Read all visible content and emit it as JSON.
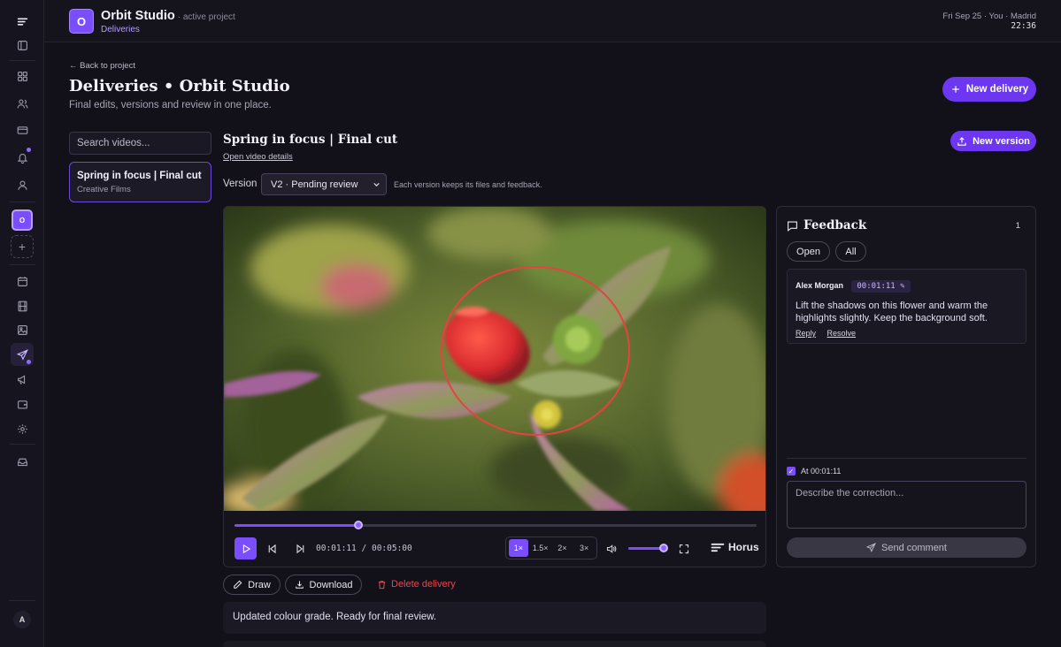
{
  "project": {
    "initial": "O",
    "name": "Orbit Studio",
    "status": "· active project",
    "breadcrumb": "Deliveries"
  },
  "clock": {
    "line1": "Fri Sep 25 · You · Madrid",
    "time": "22:36"
  },
  "sidebar": {
    "project_initial": "O",
    "add_label": "+",
    "user_initial": "A"
  },
  "page": {
    "back_link": "← Back to project",
    "title": "Deliveries • Orbit Studio",
    "subtitle": "Final edits, versions and review in one place.",
    "new_delivery": "New delivery"
  },
  "videos": {
    "search_placeholder": "Search videos...",
    "items": [
      {
        "title": "Spring in focus | Final cut",
        "client": "Creative Films"
      }
    ]
  },
  "video": {
    "title": "Spring in focus | Final cut",
    "details_link": "Open video details",
    "new_version": "New version",
    "version_label": "Version",
    "version_selected": "V2 · Pending review",
    "version_hint": "Each version keeps its files and feedback."
  },
  "player": {
    "current_time": "00:01:11",
    "separator": "/",
    "duration": "00:05:00",
    "progress": 0.237,
    "volume": 0.9,
    "speeds": [
      "1×",
      "1.5×",
      "2×",
      "3×"
    ],
    "active_speed": "1×",
    "brand": "Horus"
  },
  "actions": {
    "draw": "Draw",
    "download": "Download",
    "delete": "Delete delivery"
  },
  "notes": "Updated colour grade. Ready for final review.",
  "feedback": {
    "title": "Feedback",
    "count": "1",
    "filter_open": "Open",
    "filter_all": "All",
    "comments": [
      {
        "author": "Alex Morgan",
        "timestamp": "00:01:11 ✎",
        "body": "Lift the shadows on this flower and warm the highlights slightly. Keep the background soft.",
        "reply": "Reply",
        "resolve": "Resolve"
      }
    ],
    "at_label": "At 00:01:11",
    "correction_placeholder": "Describe the correction...",
    "send": "Send comment"
  },
  "colors": {
    "accent": "#7a4dff",
    "danger": "#e5484d",
    "annotation": "#e8423f"
  }
}
